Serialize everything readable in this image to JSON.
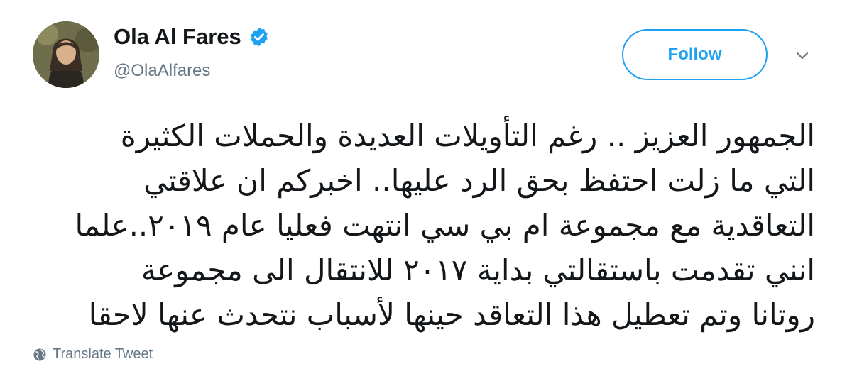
{
  "user": {
    "display_name": "Ola Al Fares",
    "handle": "@OlaAlfares",
    "verified": true,
    "avatar_icon": "profile-photo"
  },
  "actions": {
    "follow_label": "Follow",
    "menu_icon": "chevron-down-icon"
  },
  "tweet": {
    "lines": [
      "الجمهور العزيز .. رغم التأويلات العديدة والحملات الكثيرة",
      "التي ما زلت احتفظ بحق الرد عليها..  اخبركم ان علاقتي",
      "التعاقدية مع مجموعة ام بي سي انتهت فعليا عام ٢٠١٩..علما",
      "انني تقدمت باستقالتي بداية ٢٠١٧  للانتقال الى مجموعة",
      "روتانا وتم تعطيل هذا التعاقد  حينها لأسباب نتحدث عنها لاحقا"
    ]
  },
  "footer": {
    "translate_label": "Translate Tweet",
    "translate_icon": "globe-icon"
  },
  "colors": {
    "accent": "#1da1f2",
    "secondary_text": "#657786",
    "primary_text": "#14171a"
  }
}
